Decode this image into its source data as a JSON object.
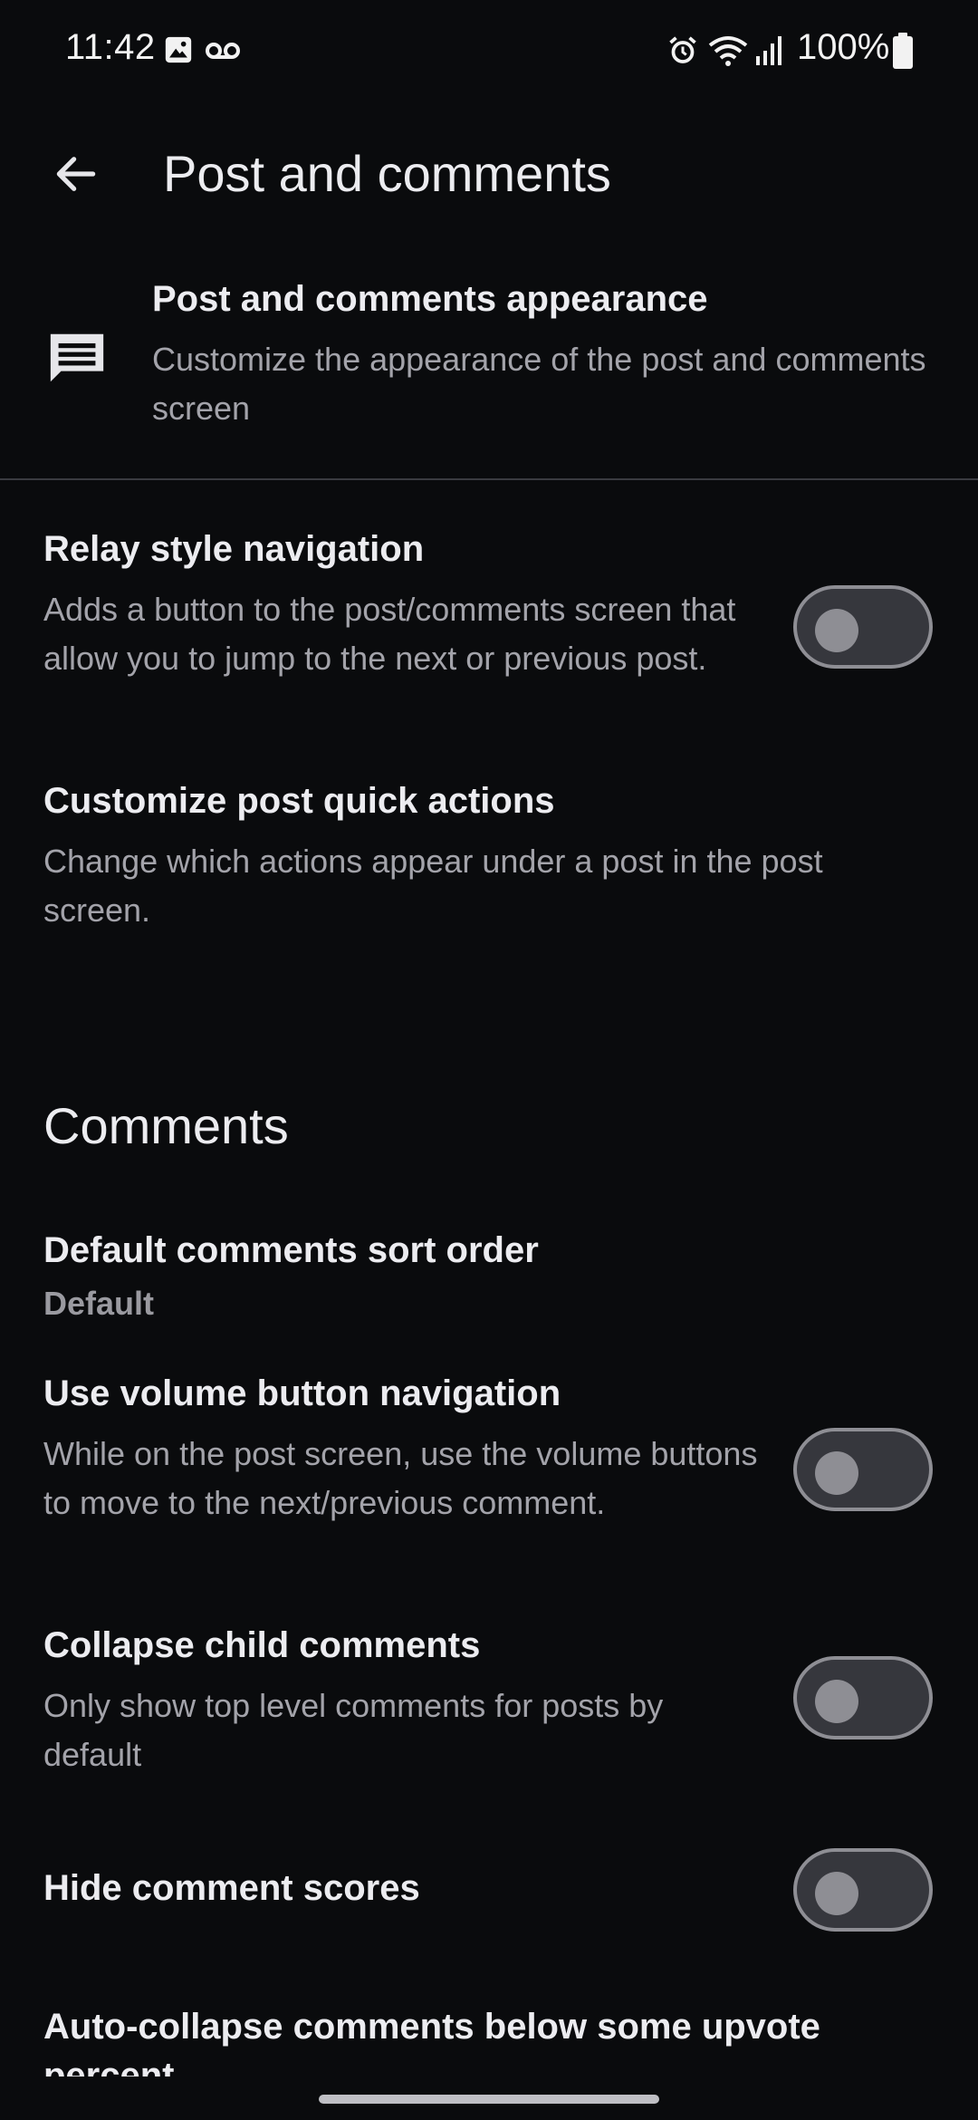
{
  "status_bar": {
    "time": "11:42",
    "battery": "100%",
    "icons": [
      "image-icon",
      "voicemail-icon",
      "alarm-icon",
      "wifi-icon",
      "signal-icon",
      "battery-icon"
    ]
  },
  "header": {
    "title": "Post and comments",
    "back_icon": "arrow-back-icon"
  },
  "appearance": {
    "title": "Post and comments appearance",
    "description": "Customize the appearance of the post and comments screen",
    "icon": "comment-icon"
  },
  "preferences": {
    "relay": {
      "title": "Relay style navigation",
      "description": "Adds a button to the post/comments screen that allow you to jump to the next or previous post.",
      "enabled": false
    },
    "quick_actions": {
      "title": "Customize post quick actions",
      "description": "Change which actions appear under a post in the post screen."
    }
  },
  "comments_section": {
    "header": "Comments",
    "sort_order": {
      "title": "Default comments sort order",
      "value": "Default"
    },
    "volume_nav": {
      "title": "Use volume button navigation",
      "description": "While on the post screen, use the volume buttons to move to the next/previous comment.",
      "enabled": false
    },
    "collapse_child": {
      "title": "Collapse child comments",
      "description": "Only show top level comments for posts by default",
      "enabled": false
    },
    "hide_scores": {
      "title": "Hide comment scores",
      "enabled": false
    },
    "auto_collapse": {
      "title": "Auto-collapse comments below some upvote percent"
    }
  },
  "colors": {
    "background": "#0a0b0d",
    "text_primary": "#ececf0",
    "text_secondary": "#a3a3aa",
    "toggle_off": "#8e8e94"
  }
}
